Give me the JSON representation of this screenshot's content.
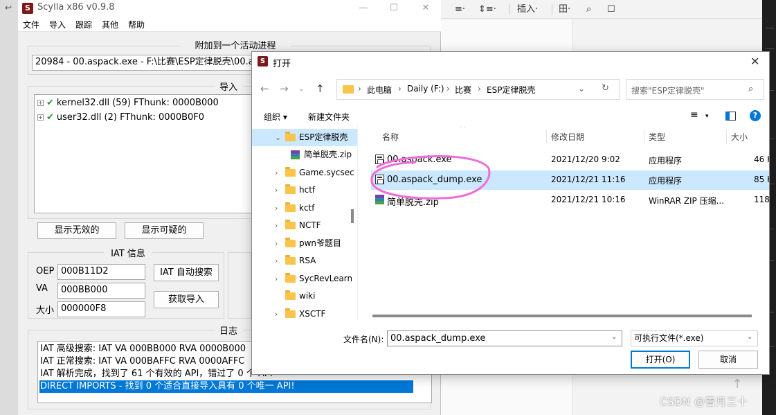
{
  "colors": {
    "accent": "#0078d7",
    "selection": "#cce8ff",
    "annotation": "#f06bd6",
    "check": "#2c9a2c"
  },
  "bg_toolbar": {
    "items": [
      "≡·",
      "⇕≡·",
      "插入·",
      "田·",
      "⌕",
      "☐"
    ]
  },
  "watermark": "CSDN @雪月三十",
  "scylla": {
    "title": "Scylla x86 v0.9.8",
    "menu": [
      "文件",
      "导入",
      "跟踪",
      "其他",
      "帮助"
    ],
    "attach_group_title": "附加到一个活动进程",
    "process_value": "20984 - 00.aspack.exe - F:\\比赛\\ESP定律脱壳\\00.a",
    "imports_group_title": "导入",
    "imports": [
      {
        "label": "kernel32.dll (59) FThunk: 0000B000"
      },
      {
        "label": "user32.dll (2) FThunk: 0000B0F0"
      }
    ],
    "btn_show_invalid": "显示无效的",
    "btn_show_suspect": "显示可疑的",
    "iat_group_title": "IAT 信息",
    "oep_label": "OEP",
    "oep_value": "000B11D2",
    "va_label": "VA",
    "va_value": "000BB000",
    "size_label": "大小",
    "size_value": "000000F8",
    "btn_iat_autosearch": "IAT 自动搜索",
    "btn_get_imports": "获取导入",
    "log_group_title": "日志",
    "log": [
      "IAT 高级搜索: IAT VA 000BB000 RVA 0000B000",
      "IAT 正常搜索: IAT VA 000BAFFC RVA 0000AFFC",
      "IAT 解析完成，找到了 61 个有效的 API，错过了 0 个 API",
      "DIRECT IMPORTS - 找到 0 个适合直接导入具有 0 个唯一 API!"
    ]
  },
  "dialog": {
    "title": "打开",
    "breadcrumb": [
      "此电脑",
      "Daily (F:)",
      "比赛",
      "ESP定律脱壳"
    ],
    "search_placeholder": "搜索\"ESP定律脱壳\"",
    "organize": "组织 ▾",
    "new_folder": "新建文件夹",
    "tree": [
      {
        "name": "ESP定律脱壳",
        "kind": "folder",
        "expanded": true,
        "selected": true
      },
      {
        "name": "简单脱壳.zip",
        "kind": "zip",
        "child": true
      },
      {
        "name": "Game.sycsec",
        "kind": "folder"
      },
      {
        "name": "hctf",
        "kind": "folder"
      },
      {
        "name": "kctf",
        "kind": "folder"
      },
      {
        "name": "NCTF",
        "kind": "folder"
      },
      {
        "name": "pwn爷题目",
        "kind": "folder"
      },
      {
        "name": "RSA",
        "kind": "folder"
      },
      {
        "name": "SycRevLearn",
        "kind": "folder"
      },
      {
        "name": "wiki",
        "kind": "folder"
      },
      {
        "name": "XSCTF",
        "kind": "folder"
      }
    ],
    "columns": {
      "name": "名称",
      "modified": "修改日期",
      "type": "类型",
      "size": "大小"
    },
    "files": [
      {
        "name": "00.aspack.exe",
        "modified": "2021/12/20 9:02",
        "type": "应用程序",
        "size": "46 K",
        "icon": "exe"
      },
      {
        "name": "00.aspack_dump.exe",
        "modified": "2021/12/21 11:16",
        "type": "应用程序",
        "size": "85 K",
        "icon": "exe",
        "selected": true
      },
      {
        "name": "简单脱壳.zip",
        "modified": "2021/12/21 10:16",
        "type": "WinRAR ZIP 压缩...",
        "size": "118 K",
        "icon": "zip"
      }
    ],
    "filename_label": "文件名(N):",
    "filename_value": "00.aspack_dump.exe",
    "filetype_value": "可执行文件(*.exe)",
    "open_button": "打开(O)",
    "cancel_button": "取消"
  }
}
